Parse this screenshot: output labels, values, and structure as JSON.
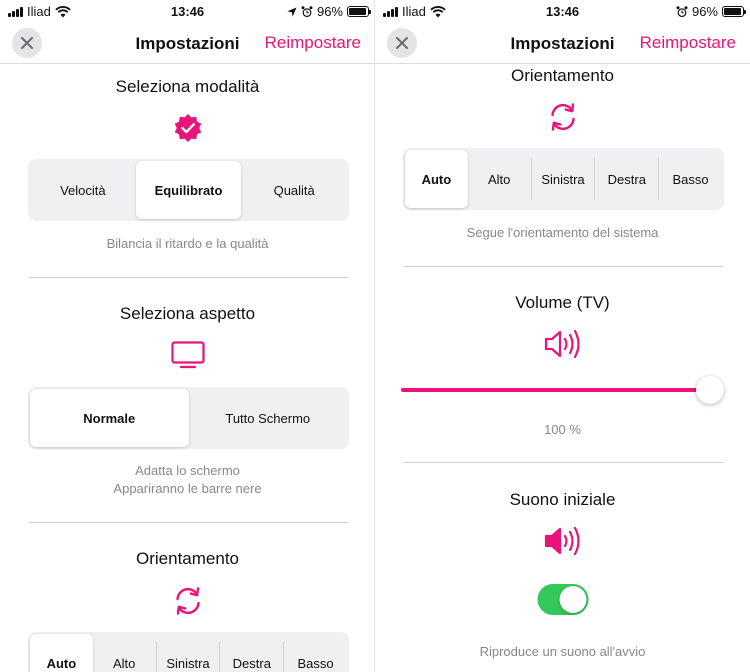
{
  "theme": {
    "accent": "#e8147a",
    "toggle_on": "#34c759"
  },
  "left": {
    "status": {
      "carrier": "Iliad",
      "time": "13:46",
      "battery": "96%",
      "battery_level": 0.96
    },
    "nav": {
      "title": "Impostazioni",
      "reset": "Reimpostare"
    },
    "mode": {
      "title": "Seleziona modalità",
      "icon": "verified-badge-icon",
      "options": [
        "Velocità",
        "Equilibrato",
        "Qualità"
      ],
      "selected": "Equilibrato",
      "caption": "Bilancia il ritardo e la qualità"
    },
    "appearance": {
      "title": "Seleziona aspetto",
      "icon": "tv-icon",
      "options": [
        "Normale",
        "Tutto Schermo"
      ],
      "selected": "Normale",
      "caption_line1": "Adatta lo schermo",
      "caption_line2": "Appariranno le barre nere"
    },
    "orientation": {
      "title": "Orientamento",
      "icon": "rotate-icon",
      "options": [
        "Auto",
        "Alto",
        "Sinistra",
        "Destra",
        "Basso"
      ],
      "selected": "Auto"
    }
  },
  "right": {
    "status": {
      "carrier": "Iliad",
      "time": "13:46",
      "battery": "96%",
      "battery_level": 0.96
    },
    "nav": {
      "title": "Impostazioni",
      "reset": "Reimpostare"
    },
    "orientation": {
      "title": "Orientamento",
      "icon": "rotate-icon",
      "options": [
        "Auto",
        "Alto",
        "Sinistra",
        "Destra",
        "Basso"
      ],
      "selected": "Auto",
      "caption": "Segue l'orientamento del sistema"
    },
    "volume": {
      "title": "Volume (TV)",
      "icon": "speaker-outline-icon",
      "value_label": "100 %",
      "level": 1.0
    },
    "startup_sound": {
      "title": "Suono iniziale",
      "icon": "speaker-filled-icon",
      "enabled": true,
      "caption": "Riproduce un suono all'avvio"
    }
  }
}
